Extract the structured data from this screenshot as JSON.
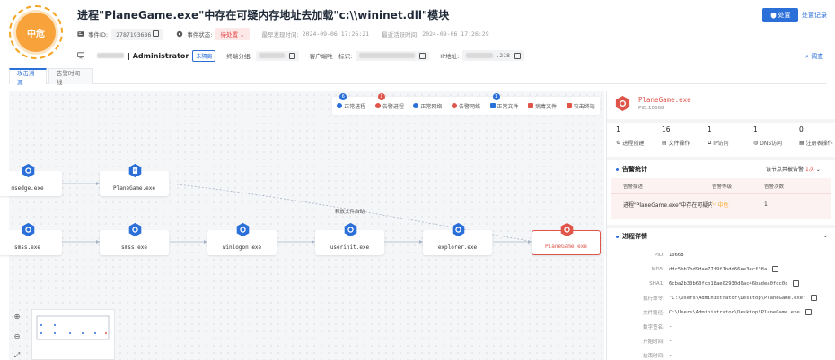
{
  "header": {
    "severity": "中危",
    "title": "进程\"PlaneGame.exe\"中存在可疑内存地址去加载\"c:\\\\wininet.dll\"模块",
    "event_id_label": "事件ID:",
    "event_id": "2787193686",
    "status_label": "事件状态:",
    "status": "待处置",
    "first_found_label": "最早发现时间:",
    "first_found": "2024-09-06 17:26:21",
    "last_active_label": "最近活跃时间:",
    "last_active": "2024-09-06 17:26:29",
    "dispose_button": "处置",
    "history_link": "处置记录",
    "host_name": "| Administrator",
    "unisolated_tag": "未隔离",
    "terminal_group_label": "终端分组:",
    "client_id_label": "客户端唯一标识:",
    "ip_label": "IP地址:",
    "ip_suffix": ".218",
    "investigate_link": "调查"
  },
  "tabs": [
    {
      "label": "攻击溯源",
      "active": true
    },
    {
      "label": "告警时间线",
      "active": false
    }
  ],
  "graph": {
    "legend": [
      {
        "label": "正常进程",
        "badge": "6",
        "badge_color": "#2b6fd9",
        "icon_color": "#2b6fd9"
      },
      {
        "label": "告警进程",
        "badge": "1",
        "badge_color": "#e0554a",
        "icon_color": "#e0554a"
      },
      {
        "label": "正常网络",
        "badge": "",
        "badge_color": "",
        "icon_color": "#2b6fd9"
      },
      {
        "label": "告警网络",
        "badge": "",
        "badge_color": "",
        "icon_color": "#e0554a"
      },
      {
        "label": "正常文件",
        "badge": "1",
        "badge_color": "#2b6fd9",
        "icon_color": "#2b6fd9"
      },
      {
        "label": "病毒文件",
        "badge": "",
        "badge_color": "",
        "icon_color": "#e0554a"
      },
      {
        "label": "攻击终端",
        "badge": "",
        "badge_color": "",
        "icon_color": "#e0554a"
      }
    ],
    "nodes": {
      "msedge": "msedge.exe",
      "planegame_file": "PlaneGame.exe",
      "smss1": "smss.exe",
      "smss2": "smss.exe",
      "winlogon": "winlogon.exe",
      "userinit": "userinit.exe",
      "explorer": "explorer.exe",
      "planegame_proc": "PlaneGame.exe"
    },
    "edge_label": "释放文件启动"
  },
  "side": {
    "proc_name": "PlaneGame.exe",
    "pid": "PID:10668",
    "stats": [
      {
        "num": "1",
        "label": "进程创建"
      },
      {
        "num": "16",
        "label": "文件操作"
      },
      {
        "num": "1",
        "label": "IP访问"
      },
      {
        "num": "1",
        "label": "DNS访问"
      },
      {
        "num": "0",
        "label": "注册表操作"
      }
    ],
    "alert_section": "告警统计",
    "alert_note_prefix": "该节点共被告警",
    "alert_note_count": "1次",
    "alert_cols": [
      "告警描述",
      "告警等级",
      "告警次数"
    ],
    "alert_row": {
      "desc": "进程\"PlaneGame.exe\"中存在可疑内...",
      "level": "中危",
      "count": "1"
    },
    "detail_section": "进程详情",
    "details": [
      {
        "k": "PID:",
        "v": "10668"
      },
      {
        "k": "MD5:",
        "v": "ddc5bb7bd9dae77f9f1bdd66ee3ecf38a"
      },
      {
        "k": "SHA1:",
        "v": "6cba2b30b60fcb18ae02930d0ac46badea0fdc0c"
      },
      {
        "k": "执行命令:",
        "v": "\"C:\\Users\\Administrator\\Desktop\\PlaneGame.exe\""
      },
      {
        "k": "文件路径:",
        "v": "C:\\Users\\Administrator\\Desktop\\PlaneGame.exe"
      },
      {
        "k": "数字签名:",
        "v": "-"
      },
      {
        "k": "开始时间:",
        "v": "-"
      },
      {
        "k": "结束时间:",
        "v": "-"
      }
    ]
  },
  "colors": {
    "primary": "#2b6fd9",
    "alert": "#e0554a",
    "medium": "#f5a623"
  }
}
